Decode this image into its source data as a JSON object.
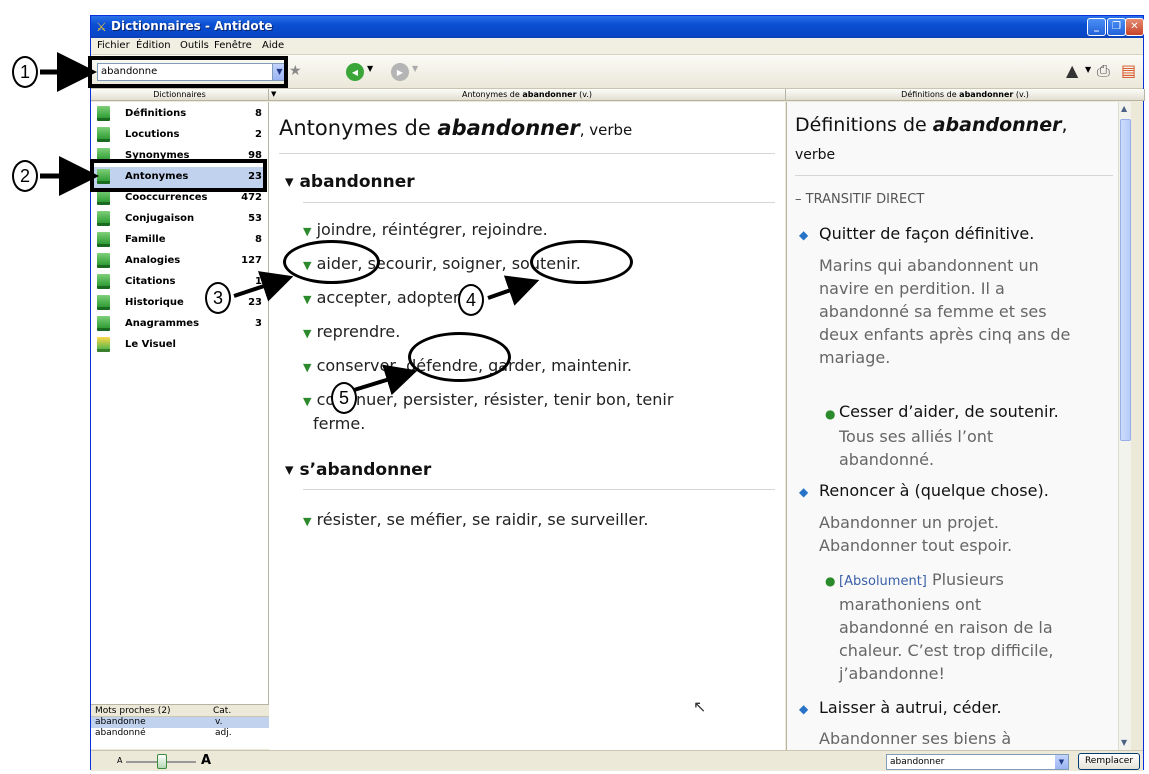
{
  "window": {
    "title": "Dictionnaires - Antidote",
    "buttons": {
      "minimize": "_",
      "maximize": "❐",
      "close": "✕"
    }
  },
  "menu": [
    "Fichier",
    "Édition",
    "Outils",
    "Fenêtre",
    "Aide"
  ],
  "toolbar": {
    "search_value": "abandonne",
    "back_icon": "◀",
    "forward_icon": "▶"
  },
  "panels": {
    "left_header": "Dictionnaires",
    "middle_header_prefix": "Antonymes de ",
    "middle_header_word": "abandonner",
    "middle_header_suffix": " (v.)",
    "right_header_prefix": "Définitions de ",
    "right_header_word": "abandonner",
    "right_header_suffix": " (v.)"
  },
  "dictionaries": [
    {
      "label": "Définitions",
      "count": "8"
    },
    {
      "label": "Locutions",
      "count": "2"
    },
    {
      "label": "Synonymes",
      "count": "98"
    },
    {
      "label": "Antonymes",
      "count": "23"
    },
    {
      "label": "Cooccurrences",
      "count": "472"
    },
    {
      "label": "Conjugaison",
      "count": "53"
    },
    {
      "label": "Famille",
      "count": "8"
    },
    {
      "label": "Analogies",
      "count": "127"
    },
    {
      "label": "Citations",
      "count": "1"
    },
    {
      "label": "Historique",
      "count": "23"
    },
    {
      "label": "Anagrammes",
      "count": "3"
    },
    {
      "label": "Le Visuel",
      "count": ""
    }
  ],
  "mots_proches": {
    "header": "Mots proches (2)",
    "cat_header": "Cat.",
    "rows": [
      {
        "word": "abandonne",
        "cat": "v."
      },
      {
        "word": "abandonné",
        "cat": "adj."
      }
    ]
  },
  "antonyms": {
    "title_prefix": "Antonymes de ",
    "title_word": "abandonner",
    "title_suffix": ", verbe",
    "section1": "abandonner",
    "lines1": [
      "joindre, réintégrer, rejoindre.",
      "aider, secourir, soigner, soutenir.",
      "accepter, adopter.",
      "reprendre.",
      "conserver, défendre, garder, maintenir.",
      "continuer, persister, résister, tenir bon, tenir",
      "ferme."
    ],
    "section2": "s’abandonner",
    "lines2": [
      "résister, se méfier, se raidir, se surveiller."
    ]
  },
  "definitions": {
    "title_prefix": "Définitions de ",
    "title_word": "abandonner",
    "title_suffix": ",",
    "pos": "verbe",
    "category": "– TRANSITIF DIRECT",
    "sense1": "Quitter de façon définitive.",
    "ex1": [
      "Marins qui abandonnent un",
      "navire en perdition. Il a",
      "abandonné sa femme et ses",
      "deux enfants après cinq ans de",
      "mariage."
    ],
    "sub1": "Cesser d’aider, de soutenir.",
    "sub1_ex": [
      "Tous ses alliés l’ont",
      "abandonné."
    ],
    "sense2": "Renoncer à (quelque chose).",
    "ex2": [
      "Abandonner un projet.",
      "Abandonner tout espoir."
    ],
    "sub2_tag": "[Absolument]",
    "sub2_ex": [
      " Plusieurs",
      "marathoniens ont",
      "abandonné en raison de la",
      "chaleur. C’est trop difficile,",
      "j’abandonne!"
    ],
    "sense3": "Laisser à autrui, céder.",
    "ex3": "Abandonner ses biens à"
  },
  "statusbar": {
    "zoom_small": "A",
    "zoom_large": "A",
    "replace_value": "abandonner",
    "replace_button": "Remplacer"
  },
  "annotations": [
    "1",
    "2",
    "3",
    "4",
    "5"
  ],
  "colors": {
    "titlebar": "#0a4ed2",
    "selection": "#c1d2ee",
    "triangle": "#2c8a2c",
    "diamond": "#2673c8",
    "back_button": "#3aa63a",
    "forward_button": "#b5b5b5"
  }
}
